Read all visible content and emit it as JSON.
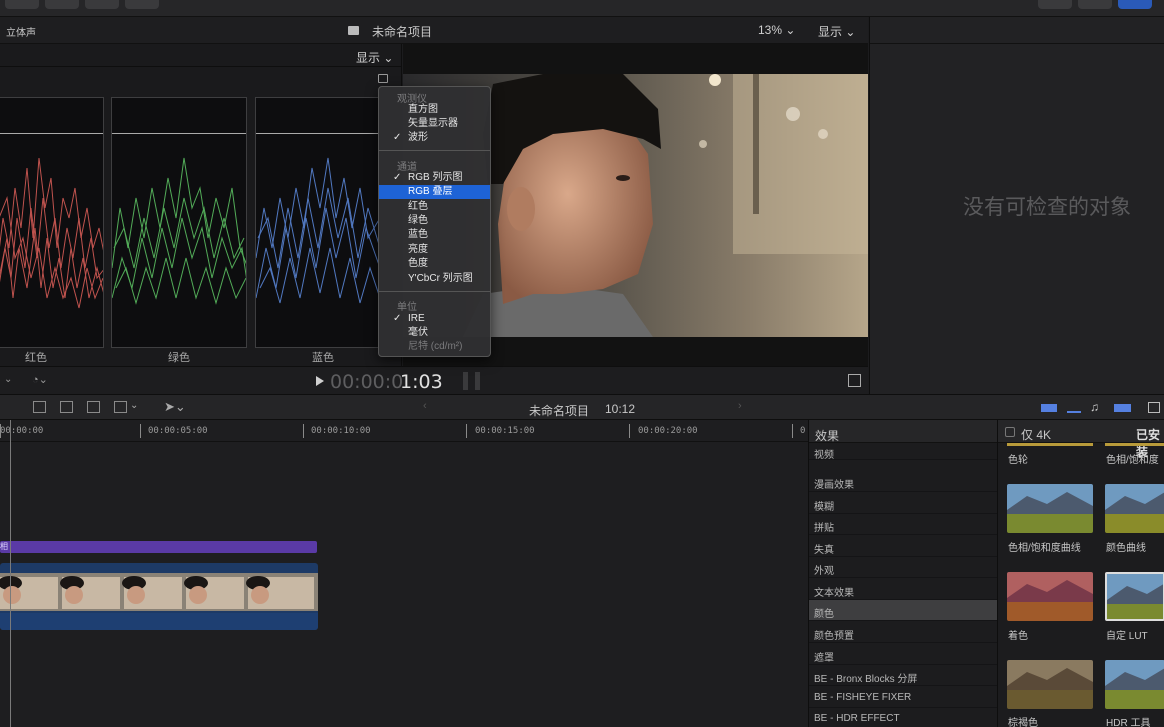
{
  "header": {
    "audio_mode": "立体声",
    "project_title": "未命名项目",
    "zoom": "13% ⌄",
    "display": "显示 ⌄"
  },
  "scopes": {
    "display": "显示 ⌄",
    "labels": [
      "红色",
      "绿色",
      "蓝色"
    ],
    "colors": [
      "#e0605a",
      "#5fc765",
      "#5d8be0"
    ]
  },
  "inspector": {
    "empty_text": "没有可检查的对象"
  },
  "transport": {
    "timecode_dim": "00:00:0",
    "timecode_bright": "1:03"
  },
  "timeline": {
    "project": "未命名项目",
    "duration": "10:12",
    "ruler": [
      "00:00:00",
      "00:00:05:00",
      "00:00:10:00",
      "00:00:15:00",
      "00:00:20:00",
      "0"
    ],
    "audio_clip_label": "相"
  },
  "effects": {
    "title": "效果",
    "items": [
      "视频",
      "漫画效果",
      "模糊",
      "拼贴",
      "失真",
      "外观",
      "文本效果",
      "颜色",
      "颜色预置",
      "遮罩",
      "BE - Bronx Blocks 分屏",
      "BE - FISHEYE FIXER",
      "BE - HDR EFFECT"
    ],
    "selected": "颜色"
  },
  "thumbs": {
    "only4k": "仅 4K",
    "installed": "已安装",
    "labels": [
      "色轮",
      "色相/饱和度",
      "色相/饱和度曲线",
      "颜色曲线",
      "着色",
      "自定 LUT",
      "棕褐色",
      "HDR 工具"
    ]
  },
  "menu": {
    "head_scope": "观测仪",
    "scope_items": [
      "直方图",
      "矢量显示器",
      "波形"
    ],
    "head_channel": "通道",
    "channel_items": [
      "RGB 列示图",
      "RGB 叠层",
      "红色",
      "绿色",
      "蓝色",
      "亮度",
      "色度",
      "Y'CbCr 列示图"
    ],
    "head_unit": "单位",
    "unit_items": [
      "IRE",
      "毫伏",
      "尼特 (cd/m²)"
    ],
    "check": "✓",
    "highlighted": "RGB 叠层"
  }
}
